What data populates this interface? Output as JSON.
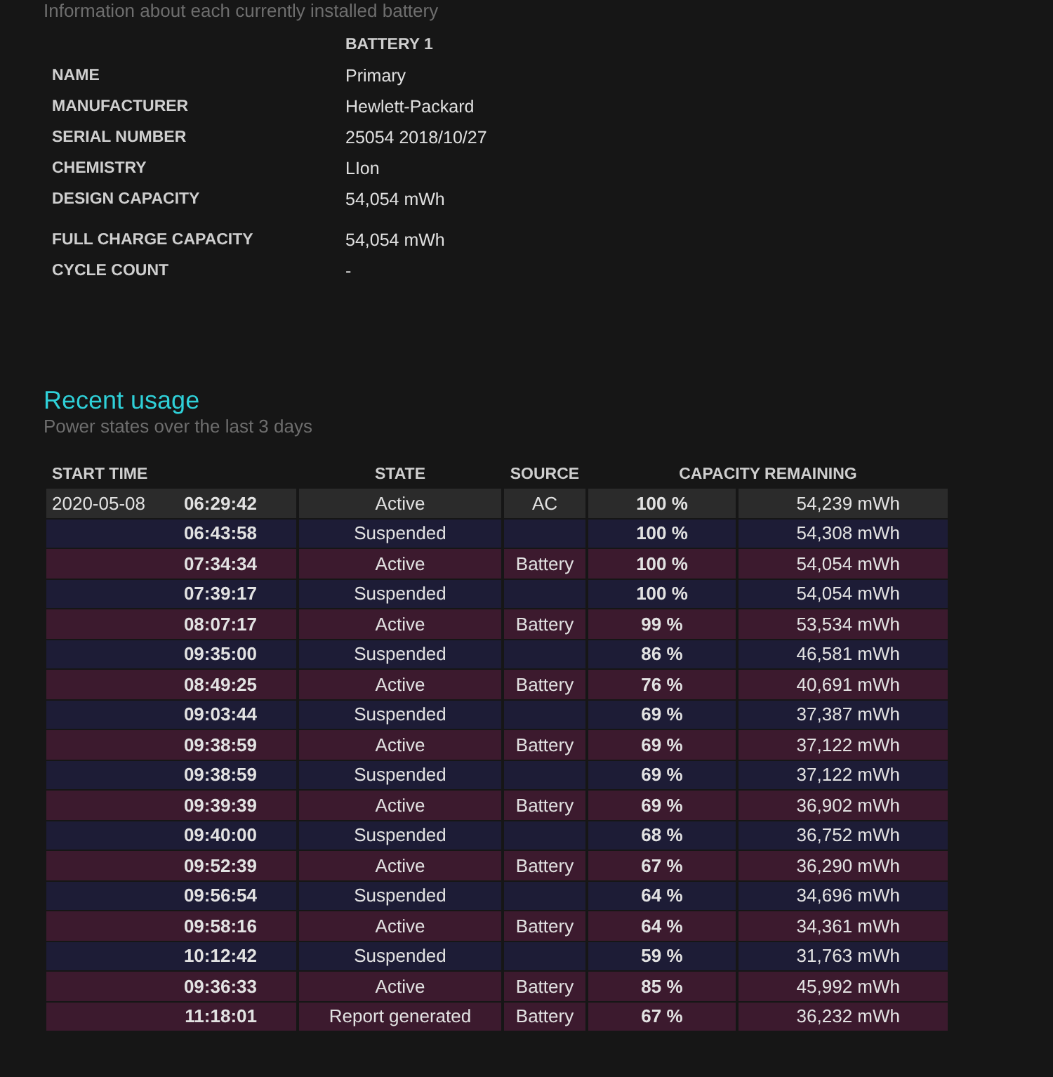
{
  "battery_section": {
    "subtitle": "Information about each currently installed battery",
    "column_header": "BATTERY 1",
    "fields": [
      {
        "label": "NAME",
        "value": "Primary"
      },
      {
        "label": "MANUFACTURER",
        "value": "Hewlett-Packard"
      },
      {
        "label": "SERIAL NUMBER",
        "value": "25054 2018/10/27"
      },
      {
        "label": "CHEMISTRY",
        "value": "LIon"
      },
      {
        "label": "DESIGN CAPACITY",
        "value": "54,054 mWh"
      },
      {
        "label": "FULL CHARGE CAPACITY",
        "value": "54,054 mWh"
      },
      {
        "label": "CYCLE COUNT",
        "value": "-"
      }
    ]
  },
  "recent_usage": {
    "title": "Recent usage",
    "subtitle": "Power states over the last 3 days",
    "table": {
      "columns": [
        "START TIME",
        "STATE",
        "SOURCE",
        "CAPACITY REMAINING"
      ],
      "rows": [
        {
          "kind": "ac",
          "date": "2020-05-08",
          "time": "06:29:42",
          "state": "Active",
          "source": "AC",
          "percent": "100 %",
          "capacity": "54,239 mWh"
        },
        {
          "kind": "suspended",
          "time": "06:43:58",
          "state": "Suspended",
          "percent": "100 %",
          "capacity": "54,308 mWh"
        },
        {
          "kind": "battery",
          "time": "07:34:34",
          "state": "Active",
          "source": "Battery",
          "percent": "100 %",
          "capacity": "54,054 mWh"
        },
        {
          "kind": "suspended",
          "time": "07:39:17",
          "state": "Suspended",
          "percent": "100 %",
          "capacity": "54,054 mWh"
        },
        {
          "kind": "battery",
          "time": "08:07:17",
          "state": "Active",
          "source": "Battery",
          "percent": "99 %",
          "capacity": "53,534 mWh"
        },
        {
          "kind": "suspended",
          "time": "09:35:00",
          "state": "Suspended",
          "percent": "86 %",
          "capacity": "46,581 mWh"
        },
        {
          "kind": "battery",
          "time": "08:49:25",
          "state": "Active",
          "source": "Battery",
          "percent": "76 %",
          "capacity": "40,691 mWh"
        },
        {
          "kind": "suspended",
          "time": "09:03:44",
          "state": "Suspended",
          "percent": "69 %",
          "capacity": "37,387 mWh"
        },
        {
          "kind": "battery",
          "time": "09:38:59",
          "state": "Active",
          "source": "Battery",
          "percent": "69 %",
          "capacity": "37,122 mWh"
        },
        {
          "kind": "suspended",
          "time": "09:38:59",
          "state": "Suspended",
          "percent": "69 %",
          "capacity": "37,122 mWh"
        },
        {
          "kind": "battery",
          "time": "09:39:39",
          "state": "Active",
          "source": "Battery",
          "percent": "69 %",
          "capacity": "36,902 mWh"
        },
        {
          "kind": "suspended",
          "time": "09:40:00",
          "state": "Suspended",
          "percent": "68 %",
          "capacity": "36,752 mWh"
        },
        {
          "kind": "battery",
          "time": "09:52:39",
          "state": "Active",
          "source": "Battery",
          "percent": "67 %",
          "capacity": "36,290 mWh"
        },
        {
          "kind": "suspended",
          "time": "09:56:54",
          "state": "Suspended",
          "percent": "64 %",
          "capacity": "34,696 mWh"
        },
        {
          "kind": "battery",
          "time": "09:58:16",
          "state": "Active",
          "source": "Battery",
          "percent": "64 %",
          "capacity": "34,361 mWh"
        },
        {
          "kind": "suspended",
          "time": "10:12:42",
          "state": "Suspended",
          "percent": "59 %",
          "capacity": "31,763 mWh"
        },
        {
          "kind": "battery",
          "time": "09:36:33",
          "state": "Active",
          "source": "Battery",
          "percent": "85 %",
          "capacity": "45,992 mWh"
        },
        {
          "kind": "battery",
          "time": "11:18:01",
          "state": "Report generated",
          "source": "Battery",
          "percent": "67 %",
          "capacity": "36,232 mWh"
        }
      ]
    }
  }
}
